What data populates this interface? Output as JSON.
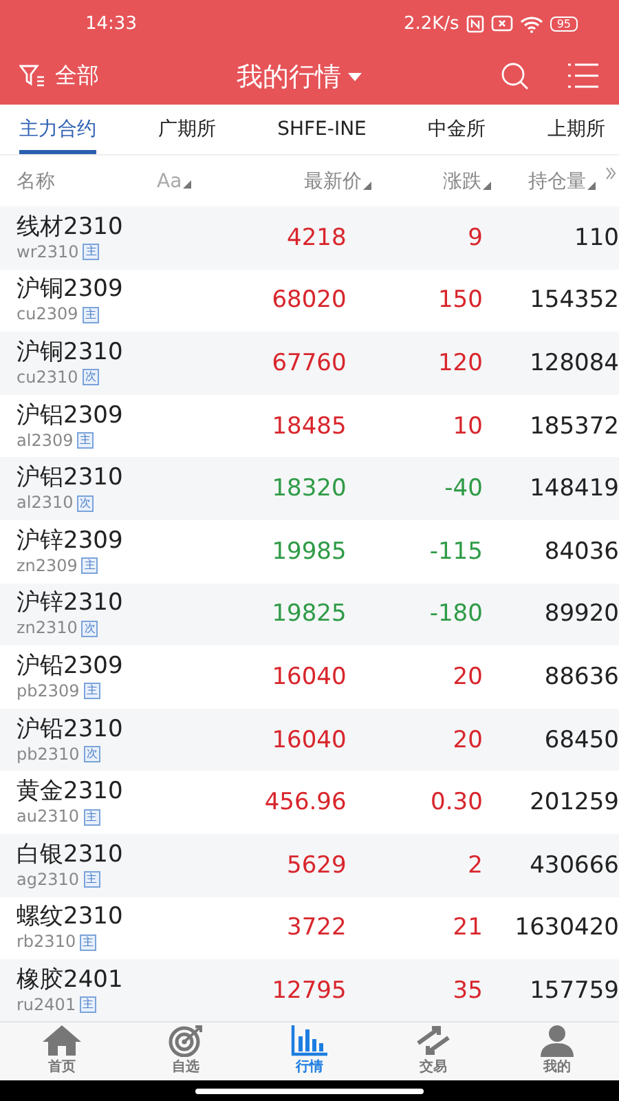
{
  "status_bar": {
    "time": "14:33",
    "speed": "2.2K/s",
    "battery": "95"
  },
  "header": {
    "filter_label": "全部",
    "title": "我的行情"
  },
  "tabs": [
    {
      "label": "主力合约",
      "selected": true
    },
    {
      "label": "广期所",
      "selected": false
    },
    {
      "label": "SHFE-INE",
      "selected": false
    },
    {
      "label": "中金所",
      "selected": false
    },
    {
      "label": "上期所",
      "selected": false
    }
  ],
  "table": {
    "columns": [
      "名称",
      "Aa",
      "最新价",
      "涨跌",
      "持仓量"
    ],
    "rows": [
      {
        "name": "线材2310",
        "code": "wr2310",
        "tag": "主",
        "price": "4218",
        "change": "9",
        "open_interest": "110",
        "color": "#d8262c"
      },
      {
        "name": "沪铜2309",
        "code": "cu2309",
        "tag": "主",
        "price": "68020",
        "change": "150",
        "open_interest": "154352",
        "color": "#d8262c"
      },
      {
        "name": "沪铜2310",
        "code": "cu2310",
        "tag": "次",
        "price": "67760",
        "change": "120",
        "open_interest": "128084",
        "color": "#d8262c"
      },
      {
        "name": "沪铝2309",
        "code": "al2309",
        "tag": "主",
        "price": "18485",
        "change": "10",
        "open_interest": "185372",
        "color": "#d8262c"
      },
      {
        "name": "沪铝2310",
        "code": "al2310",
        "tag": "次",
        "price": "18320",
        "change": "-40",
        "open_interest": "148419",
        "color": "#2f9b46"
      },
      {
        "name": "沪锌2309",
        "code": "zn2309",
        "tag": "主",
        "price": "19985",
        "change": "-115",
        "open_interest": "84036",
        "color": "#2f9b46"
      },
      {
        "name": "沪锌2310",
        "code": "zn2310",
        "tag": "次",
        "price": "19825",
        "change": "-180",
        "open_interest": "89920",
        "color": "#2f9b46"
      },
      {
        "name": "沪铅2309",
        "code": "pb2309",
        "tag": "主",
        "price": "16040",
        "change": "20",
        "open_interest": "88636",
        "color": "#d8262c"
      },
      {
        "name": "沪铅2310",
        "code": "pb2310",
        "tag": "次",
        "price": "16040",
        "change": "20",
        "open_interest": "68450",
        "color": "#d8262c"
      },
      {
        "name": "黄金2310",
        "code": "au2310",
        "tag": "主",
        "price": "456.96",
        "change": "0.30",
        "open_interest": "201259",
        "color": "#d8262c"
      },
      {
        "name": "白银2310",
        "code": "ag2310",
        "tag": "主",
        "price": "5629",
        "change": "2",
        "open_interest": "430666",
        "color": "#d8262c"
      },
      {
        "name": "螺纹2310",
        "code": "rb2310",
        "tag": "主",
        "price": "3722",
        "change": "21",
        "open_interest": "1630420",
        "color": "#d8262c"
      },
      {
        "name": "橡胶2401",
        "code": "ru2401",
        "tag": "主",
        "price": "12795",
        "change": "35",
        "open_interest": "157759",
        "color": "#d8262c"
      }
    ]
  },
  "bottom_nav": [
    {
      "label": "首页",
      "kind": "home",
      "selected": false
    },
    {
      "label": "自选",
      "kind": "target",
      "selected": false
    },
    {
      "label": "行情",
      "kind": "chart",
      "selected": true
    },
    {
      "label": "交易",
      "kind": "trade",
      "selected": false
    },
    {
      "label": "我的",
      "kind": "person",
      "selected": false
    }
  ]
}
